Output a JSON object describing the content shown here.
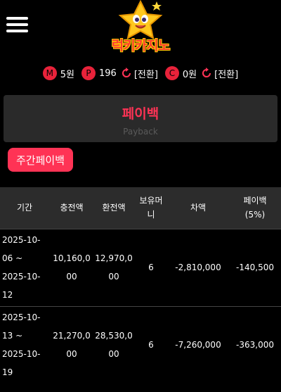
{
  "header": {
    "logo_text": "럭키카지노"
  },
  "balance": {
    "m": {
      "badge": "M",
      "value": "5원"
    },
    "p": {
      "badge": "P",
      "value": "196",
      "convert_label": "[전환]"
    },
    "c": {
      "badge": "C",
      "value": "0원",
      "convert_label": "[전환]"
    }
  },
  "page": {
    "title": "페이백",
    "subtitle": "Payback",
    "weekly_button": "주간페이백"
  },
  "table": {
    "headers": [
      "기간",
      "충전액",
      "환전액",
      "보유머니",
      "차액",
      "페이백\n(5%)"
    ],
    "rows": [
      {
        "period": "2025-10-06 ~ 2025-10-12",
        "charge": "10,160,000",
        "exchange": "12,970,000",
        "money": "6",
        "diff": "-2,810,000",
        "payback": "-140,500"
      },
      {
        "period": "2025-10-13 ~ 2025-10-19",
        "charge": "21,270,000",
        "exchange": "28,530,000",
        "money": "6",
        "diff": "-7,260,000",
        "payback": "-363,000"
      }
    ]
  },
  "colors": {
    "accent": "#ff3355",
    "badge": "#e8223a",
    "background": "#000000",
    "panel": "#2a2a2a"
  }
}
